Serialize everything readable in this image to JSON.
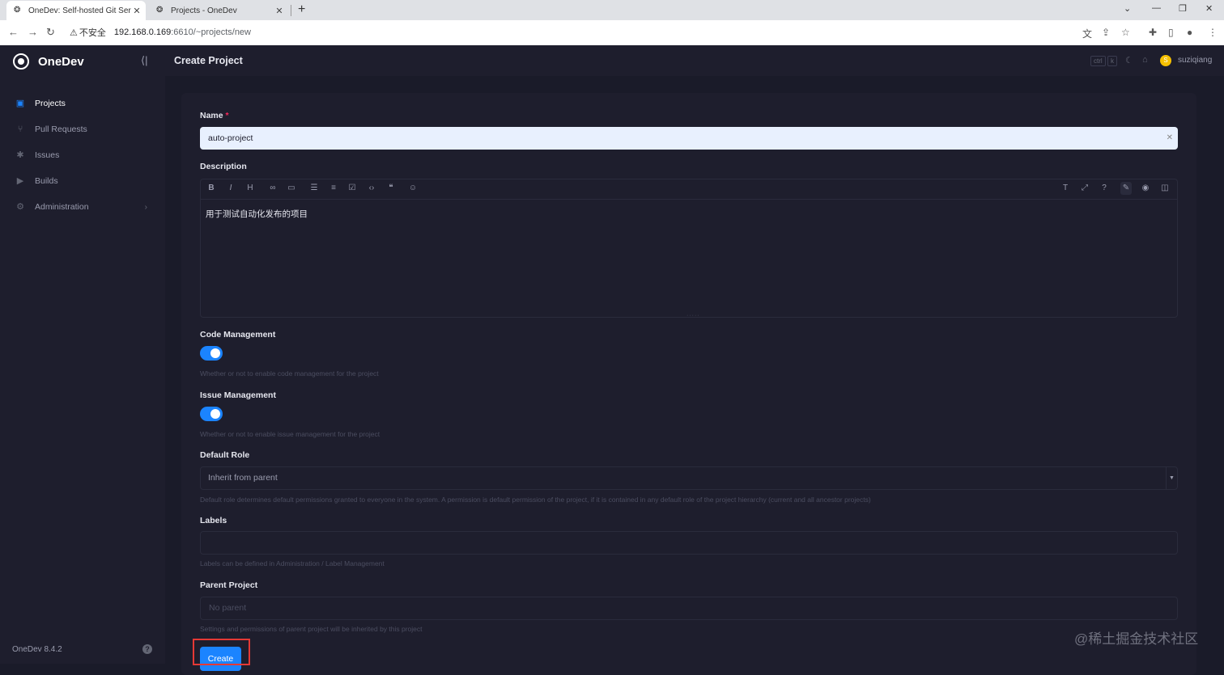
{
  "browser": {
    "tabs": [
      {
        "label": "OneDev: Self-hosted Git Serve",
        "active": true
      },
      {
        "label": "Projects - OneDev",
        "active": false
      }
    ],
    "security_label": "不安全",
    "url_host": "192.168.0.169",
    "url_path": ":6610/~projects/new"
  },
  "sidebar": {
    "brand": "OneDev",
    "items": [
      {
        "label": "Projects",
        "icon": "projects-icon",
        "active": true
      },
      {
        "label": "Pull Requests",
        "icon": "pull-request-icon"
      },
      {
        "label": "Issues",
        "icon": "issue-icon"
      },
      {
        "label": "Builds",
        "icon": "build-icon"
      },
      {
        "label": "Administration",
        "icon": "gear-icon"
      }
    ],
    "version": "OneDev 8.4.2"
  },
  "header": {
    "title": "Create Project",
    "shortcut_keys": [
      "ctrl",
      "k"
    ],
    "username": "suziqiang",
    "avatar_letter": "S"
  },
  "form": {
    "name": {
      "label": "Name",
      "required_mark": "*",
      "value": "auto-project"
    },
    "description": {
      "label": "Description",
      "value": "用于测试自动化发布的项目"
    },
    "code_management": {
      "label": "Code Management",
      "enabled": true,
      "hint": "Whether or not to enable code management for the project"
    },
    "issue_management": {
      "label": "Issue Management",
      "enabled": true,
      "hint": "Whether or not to enable issue management for the project"
    },
    "default_role": {
      "label": "Default Role",
      "value": "Inherit from parent",
      "hint": "Default role determines default permissions granted to everyone in the system. A permission is default permission of the project, if it is contained in any default role of the project hierarchy (current and all ancestor projects)"
    },
    "labels": {
      "label": "Labels",
      "value": "",
      "hint": "Labels can be defined in Administration / Label Management"
    },
    "parent_project": {
      "label": "Parent Project",
      "placeholder": "No parent",
      "hint": "Settings and permissions of parent project will be inherited by this project"
    },
    "submit_label": "Create"
  },
  "watermark": "@稀土掘金技术社区",
  "colors": {
    "accent": "#1b84ff",
    "background": "#1a1b29",
    "panel": "#1e1e2d",
    "highlight": "#e53935"
  }
}
